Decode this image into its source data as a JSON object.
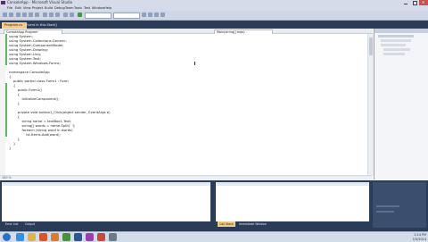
{
  "window": {
    "title": "ConsoleApp - Microsoft Visual Studio"
  },
  "menu": {
    "items": [
      "File",
      "Edit",
      "View",
      "Project",
      "Build",
      "Debug",
      "Team",
      "Tools",
      "Test",
      "Window",
      "Help"
    ]
  },
  "tabs": [
    {
      "label": "Program.cs",
      "active": true
    },
    {
      "label": "Event in this.Start()",
      "active": false
    }
  ],
  "nav": {
    "class_dropdown": "ConsoleApp.Program",
    "member_dropdown": "Main(string[] args)"
  },
  "code": {
    "lines": [
      "using System;",
      "using System.Collections.Generic;",
      "using System.ComponentModel;",
      "using System.Drawing;",
      "using System.Linq;",
      "using System.Text;",
      "using System.Windows.Forms;",
      "",
      "namespace ConsoleApp",
      "{",
      "    public partial class Form1 : Form",
      "    {",
      "        public Form1()",
      "        {",
      "            InitializeComponent();",
      "        }",
      "",
      "        private void button1_Click(object sender, EventArgs e)",
      "        {",
      "            string name = textBox1.Text;",
      "            string[] words = name.Split(' ');",
      "            foreach (string word in words)",
      "                lst.Items.Add(word);",
      "        }",
      "    }",
      "}"
    ]
  },
  "zoom": "100 %",
  "bottom_tabs": {
    "left": [
      "Error List",
      "Output"
    ],
    "right": [
      "Call Stack",
      "Immediate Window"
    ]
  },
  "tray": {
    "time": "2:14 PM",
    "date": "1/5/2014"
  },
  "colors": {
    "chrome": "#d6dbe9",
    "tab_active": "#f5cc84",
    "dark_frame": "#2b3c59",
    "change_bar": "#5cba5c"
  }
}
